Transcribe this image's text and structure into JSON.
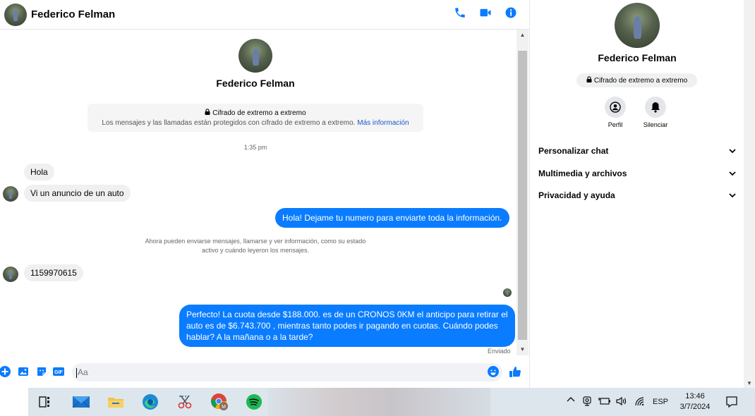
{
  "header": {
    "contact_name": "Federico Felman",
    "icons": [
      "phone-icon",
      "video-icon",
      "info-icon"
    ]
  },
  "intro": {
    "name": "Federico Felman",
    "e2e_title": "Cifrado de extremo a extremo",
    "e2e_text": "Los mensajes y las llamadas están protegidos con cifrado de extremo a extremo.",
    "e2e_link": "Más información",
    "time": "1:35 pm"
  },
  "messages": [
    {
      "from": "them",
      "text": "Hola"
    },
    {
      "from": "them",
      "text": "Vi un anuncio de un auto"
    },
    {
      "from": "me",
      "text": "Hola! Dejame tu numero  para enviarte toda la información."
    },
    {
      "from": "them",
      "text": "1159970615"
    },
    {
      "from": "me",
      "lines": [
        "Perfecto! La cuota desde $188.000. es de un CRONOS 0KM el anticipo para retirar el",
        "auto es de $6.743.700 , mientras tanto podes ir pagando en cuotas. Cuándo podes",
        "hablar? A la mañana o a la tarde?"
      ]
    }
  ],
  "info_note": {
    "line1": "Ahora pueden enviarse mensajes, llamarse y ver información, como su estado",
    "line2": "activo y cuándo leyeron los mensajes."
  },
  "message_status": "Enviado",
  "composer": {
    "placeholder": "Aa",
    "icons": [
      "plus-icon",
      "image-icon",
      "sticker-icon",
      "gif-icon",
      "emoji-icon",
      "like-icon"
    ]
  },
  "panel": {
    "name": "Federico Felman",
    "badge": "Cifrado de extremo a extremo",
    "actions": [
      {
        "label": "Perfil",
        "icon": "profile-icon"
      },
      {
        "label": "Silenciar",
        "icon": "bell-icon"
      }
    ],
    "sections": [
      "Personalizar chat",
      "Multimedia y archivos",
      "Privacidad y ayuda"
    ]
  },
  "taskbar": {
    "apps": [
      "task-view",
      "mail",
      "file-explorer",
      "edge",
      "snipping-tool",
      "chrome",
      "spotify"
    ],
    "lang": "ESP",
    "time": "13:46",
    "date": "3/7/2024"
  },
  "colors": {
    "accent": "#0a7cff",
    "incoming_bubble": "#f0f0f0",
    "link": "#1a58c7"
  }
}
